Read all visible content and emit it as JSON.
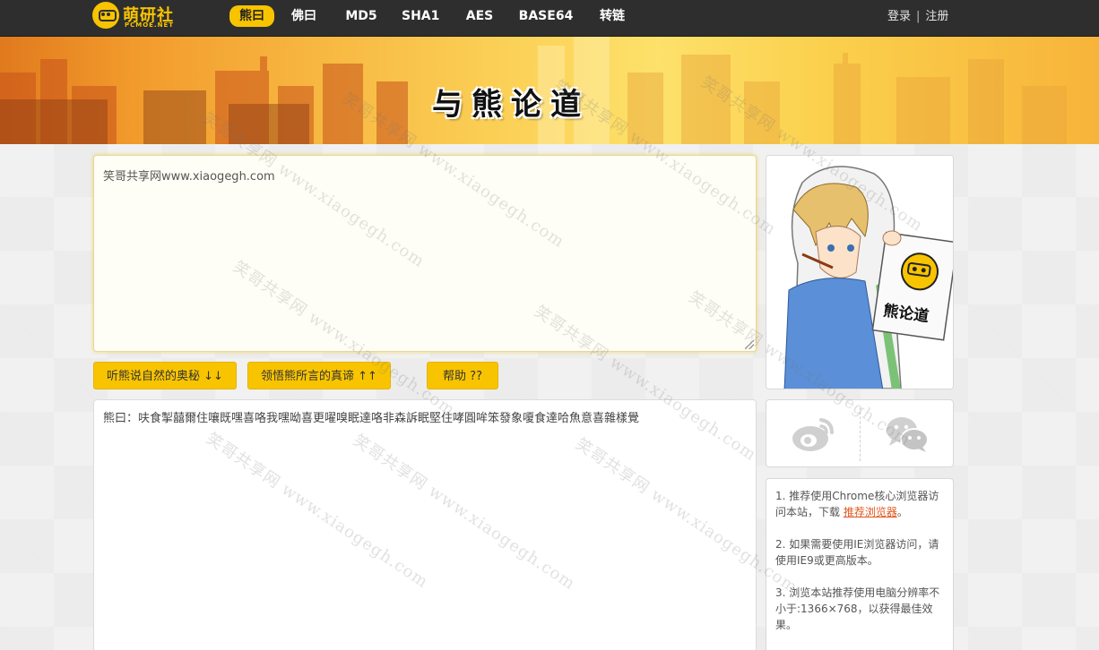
{
  "brand": {
    "name": "萌研社",
    "sub": "PCMOE.NET"
  },
  "nav": {
    "items": [
      {
        "label": "熊曰",
        "active": true
      },
      {
        "label": "佛曰",
        "active": false
      },
      {
        "label": "MD5",
        "active": false
      },
      {
        "label": "SHA1",
        "active": false
      },
      {
        "label": "AES",
        "active": false
      },
      {
        "label": "BASE64",
        "active": false
      },
      {
        "label": "转链",
        "active": false
      }
    ]
  },
  "auth": {
    "login": "登录",
    "separator": "|",
    "register": "注册"
  },
  "banner": {
    "title": "与熊论道"
  },
  "input": {
    "value": "笑哥共享网www.xiaogegh.com"
  },
  "buttons": {
    "decode": "听熊说自然的奥秘 ↓↓",
    "encode": "领悟熊所言的真谛 ↑↑",
    "help": "帮助 ??"
  },
  "output": {
    "value": "熊曰：呋食掣囍爾住嚷既嘿喜咯我嘿呦喜更嚁嗅眠達咯非森訴眠堅住哮圓哞笨發象嗄食達哈魚意喜雜樣覺"
  },
  "avatar": {
    "sign_text": "熊论道"
  },
  "tips": [
    {
      "text": "1. 推荐使用Chrome核心浏览器访问本站，下载 ",
      "link": "推荐浏览器",
      "suffix": "。"
    },
    {
      "text": "2. 如果需要使用IE浏览器访问，请使用IE9或更高版本。"
    },
    {
      "text": "3. 浏览本站推荐使用电脑分辨率不小于:1366×768，以获得最佳效果。"
    }
  ],
  "watermark": {
    "cn": "笑哥共享网",
    "url": "www.xiaogegh.com"
  },
  "colors": {
    "topbar": "#2e2e2e",
    "accent": "#f8c400",
    "link": "#e0571e"
  }
}
